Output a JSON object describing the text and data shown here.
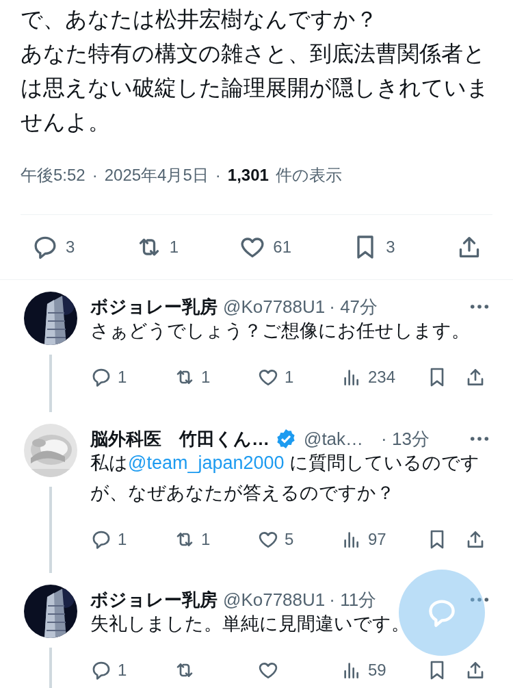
{
  "main_post": {
    "paragraphs": [
      "で、あなたは松井宏樹なんですか？",
      "あなた特有の構文の雑さと、到底法曹関係者とは思えない破綻した論理展開が隠しきれていませんよ。"
    ],
    "meta": [
      {
        "kind": "text",
        "text": "午後5:52"
      },
      {
        "kind": "sep",
        "text": "·"
      },
      {
        "kind": "text",
        "text": "2025年4月5日"
      },
      {
        "kind": "sep",
        "text": "·"
      },
      {
        "kind": "strong",
        "text": "1,301"
      },
      {
        "kind": "text",
        "text": "件の表示"
      }
    ],
    "actions": [
      {
        "kind": "reply",
        "count": "3"
      },
      {
        "kind": "repost",
        "count": "1"
      },
      {
        "kind": "like",
        "count": "61"
      },
      {
        "kind": "bookmark",
        "count": "3"
      },
      {
        "kind": "share"
      }
    ]
  },
  "replies": [
    {
      "name": "ボジョレー乳房",
      "verified": false,
      "handle": "@Ko7788U1",
      "time": "· 47分",
      "text": [
        {
          "kind": "text",
          "text": "さぁどうでしょう？ご想像にお任せします。"
        }
      ],
      "actions": [
        {
          "kind": "reply",
          "count": "1"
        },
        {
          "kind": "repost",
          "count": "1"
        },
        {
          "kind": "like",
          "count": "1"
        },
        {
          "kind": "views",
          "count": "234"
        },
        {
          "kind": "bookmark"
        },
        {
          "kind": "share"
        }
      ]
    },
    {
      "name": "脳外科医　竹田くん…",
      "verified": true,
      "handle": "@tak…",
      "time": "· 13分",
      "text": [
        {
          "kind": "text",
          "text": "私は"
        },
        {
          "kind": "mention",
          "text": "@team_japan2000"
        },
        {
          "kind": "text",
          "text": " に質問しているのですが、なぜあなたが答えるのですか？"
        }
      ],
      "actions": [
        {
          "kind": "reply",
          "count": "1"
        },
        {
          "kind": "repost",
          "count": "1"
        },
        {
          "kind": "like",
          "count": "5"
        },
        {
          "kind": "views",
          "count": "97"
        },
        {
          "kind": "bookmark"
        },
        {
          "kind": "share"
        }
      ]
    },
    {
      "name": "ボジョレー乳房",
      "verified": false,
      "handle": "@Ko7788U1",
      "time": "· 11分",
      "text": [
        {
          "kind": "text",
          "text": "失礼しました。単純に見間違いです。"
        }
      ],
      "actions": [
        {
          "kind": "reply",
          "count": "1"
        },
        {
          "kind": "repost"
        },
        {
          "kind": "like"
        },
        {
          "kind": "views",
          "count": "59"
        },
        {
          "kind": "bookmark"
        },
        {
          "kind": "share"
        }
      ]
    }
  ],
  "compose_button": {
    "kind": "floating"
  }
}
